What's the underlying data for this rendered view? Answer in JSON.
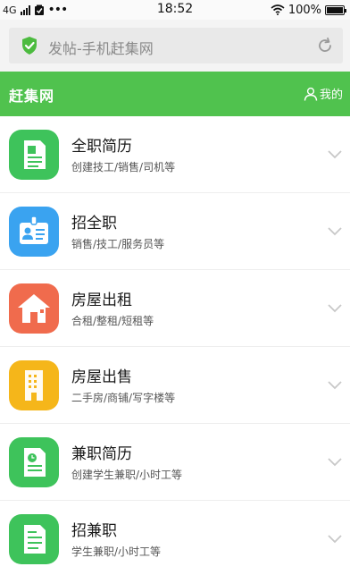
{
  "status_bar": {
    "network": "4G",
    "time": "18:52",
    "battery": "100%",
    "battery_level": 1.0,
    "icons": [
      "signal-icon",
      "notification-icon",
      "more-dots-icon",
      "wifi-icon",
      "battery-icon"
    ]
  },
  "url_bar": {
    "text": "发帖-手机赶集网",
    "icons": [
      "shield-check-icon",
      "reload-icon"
    ]
  },
  "header": {
    "brand": "赶集网",
    "mine_label": "我的",
    "icons": [
      "user-icon"
    ]
  },
  "items": [
    {
      "title": "全职简历",
      "sub": "创建技工/销售/司机等",
      "icon": "resume-icon",
      "color": "#3ec35b"
    },
    {
      "title": "招全职",
      "sub": "销售/技工/服务员等",
      "icon": "badge-icon",
      "color": "#3aa3f0"
    },
    {
      "title": "房屋出租",
      "sub": "合租/整租/短租等",
      "icon": "house-icon",
      "color": "#f06b4d"
    },
    {
      "title": "房屋出售",
      "sub": "二手房/商铺/写字楼等",
      "icon": "building-icon",
      "color": "#f5b61a"
    },
    {
      "title": "兼职简历",
      "sub": "创建学生兼职/小时工等",
      "icon": "part-time-resume-icon",
      "color": "#3ec35b"
    },
    {
      "title": "招兼职",
      "sub": "学生兼职/小时工等",
      "icon": "document-icon",
      "color": "#3ec35b"
    }
  ],
  "colors": {
    "header_green": "#50c24e",
    "chevron": "#c8c8c8"
  }
}
